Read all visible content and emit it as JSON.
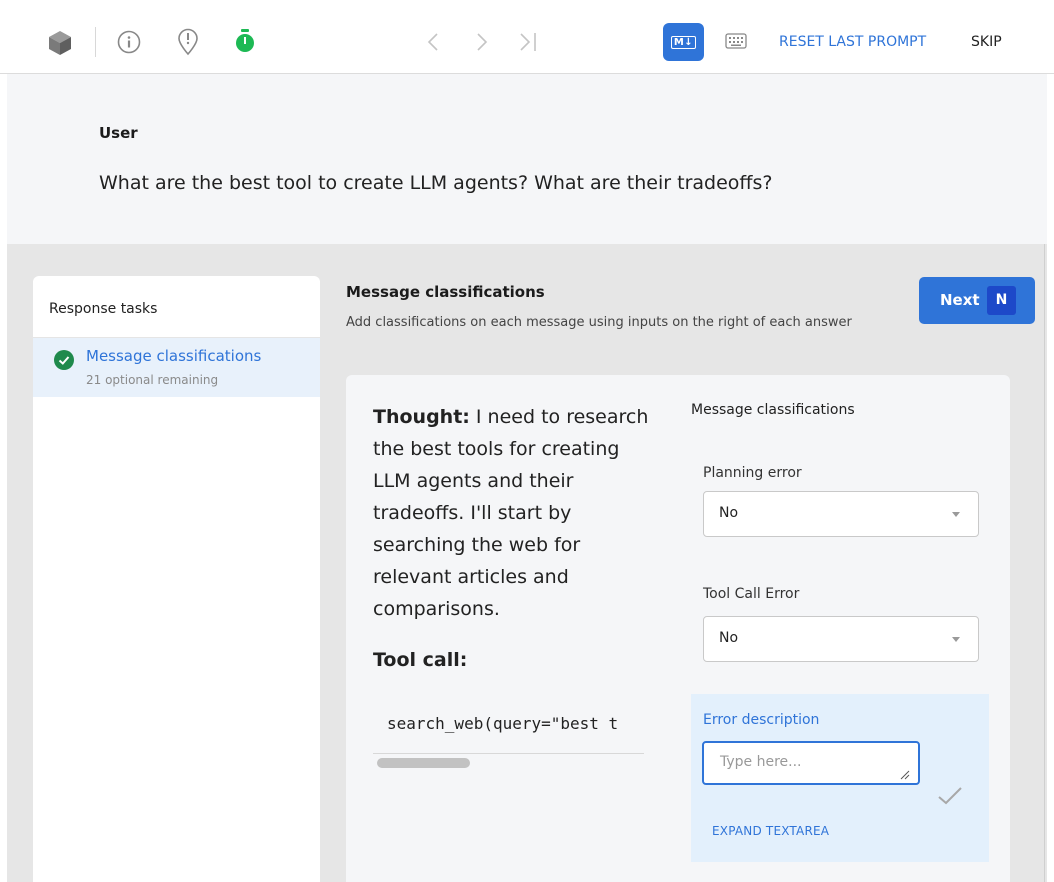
{
  "toolbar": {
    "icons": [
      "cube-icon",
      "info-icon",
      "alert-pin-icon",
      "timer-icon",
      "chevron-left-icon",
      "chevron-right-icon",
      "skip-to-end-icon",
      "markdown-icon",
      "keyboard-icon"
    ],
    "markdown_label": "M↓",
    "reset_label": "RESET LAST PROMPT",
    "skip_label": "SKIP",
    "colors": {
      "accent": "#2f74d8",
      "timer": "#1db954"
    }
  },
  "prompt": {
    "role": "User",
    "text": "What are the best tool to create LLM agents? What are their tradeoffs?"
  },
  "tasks": {
    "header": "Response tasks",
    "items": [
      {
        "title": "Message classifications",
        "subtitle": "21 optional remaining",
        "status": "complete"
      }
    ]
  },
  "main": {
    "title": "Message classifications",
    "subtitle": "Add classifications on each message using inputs on the right of each answer",
    "next": {
      "label": "Next",
      "shortcut": "N"
    }
  },
  "message": {
    "thought_label": "Thought:",
    "thought_text": " I need to research the best tools for creating LLM agents and their tradeoffs. I'll start by searching the web for relevant articles and comparisons.",
    "tool_call_label": "Tool call:",
    "code": "search_web(query=\"best t"
  },
  "classifications": {
    "header": "Message classifications",
    "planning_error": {
      "label": "Planning error",
      "value": "No"
    },
    "tool_call_error": {
      "label": "Tool Call Error",
      "value": "No"
    },
    "error_description": {
      "label": "Error description",
      "placeholder": "Type here...",
      "expand_label": "EXPAND TEXTAREA"
    }
  }
}
